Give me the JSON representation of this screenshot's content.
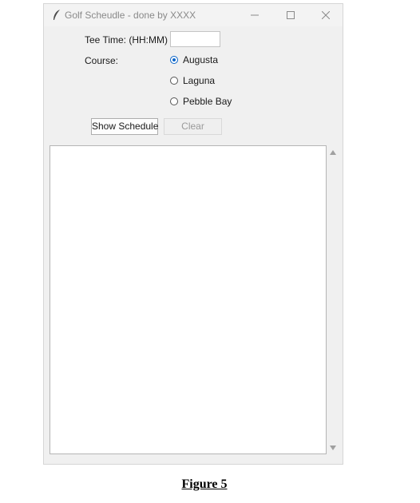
{
  "window": {
    "title": "Golf Scheudle - done by XXXX",
    "icon": "feather-icon",
    "controls": [
      "minimize-icon",
      "maximize-icon",
      "close-icon"
    ]
  },
  "form": {
    "tee_time_label": "Tee Time: (HH:MM)",
    "tee_time_value": "",
    "course_label": "Course:",
    "courses": [
      {
        "label": "Augusta",
        "selected": true
      },
      {
        "label": "Laguna",
        "selected": false
      },
      {
        "label": "Pebble Bay",
        "selected": false
      }
    ]
  },
  "buttons": {
    "show_schedule": "Show Schedule",
    "clear": "Clear",
    "clear_disabled": true
  },
  "output": {
    "text": ""
  },
  "caption": "Figure 5",
  "colors": {
    "accent": "#0a64c8",
    "window_bg": "#f0f0f0",
    "disabled_text": "#9a9a9a"
  }
}
